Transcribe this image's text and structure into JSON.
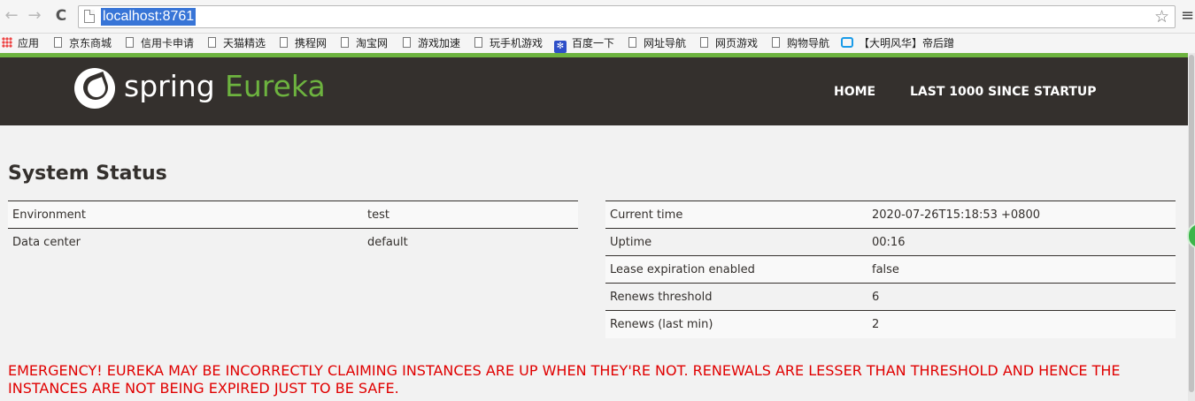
{
  "browser": {
    "url": "localhost:8761",
    "back_glyph": "←",
    "forward_glyph": "→",
    "reload_glyph": "C",
    "star_glyph": "☆",
    "menu_glyph": "≡",
    "bookmarks": [
      {
        "label": "应用",
        "icon": "apps-grid-icon"
      },
      {
        "label": "京东商城",
        "icon": "page-icon"
      },
      {
        "label": "信用卡申请",
        "icon": "page-icon"
      },
      {
        "label": "天猫精选",
        "icon": "page-icon"
      },
      {
        "label": "携程网",
        "icon": "page-icon"
      },
      {
        "label": "淘宝网",
        "icon": "page-icon"
      },
      {
        "label": "游戏加速",
        "icon": "page-icon"
      },
      {
        "label": "玩手机游戏",
        "icon": "page-icon"
      },
      {
        "label": "百度一下",
        "icon": "baidu-paw-icon"
      },
      {
        "label": "网址导航",
        "icon": "page-icon"
      },
      {
        "label": "网页游戏",
        "icon": "page-icon"
      },
      {
        "label": "购物导航",
        "icon": "page-icon"
      },
      {
        "label": "【大明风华】帝后蹭",
        "icon": "bilibili-tv-icon"
      }
    ]
  },
  "header": {
    "brand_spring": "spring",
    "brand_eureka": "Eureka",
    "nav": {
      "home": "HOME",
      "last1000": "LAST 1000 SINCE STARTUP"
    }
  },
  "main": {
    "section_title": "System Status",
    "left_table": [
      {
        "key": "Environment",
        "value": "test"
      },
      {
        "key": "Data center",
        "value": "default"
      }
    ],
    "right_table": [
      {
        "key": "Current time",
        "value": "2020-07-26T15:18:53 +0800"
      },
      {
        "key": "Uptime",
        "value": "00:16"
      },
      {
        "key": "Lease expiration enabled",
        "value": "false"
      },
      {
        "key": "Renews threshold",
        "value": "6"
      },
      {
        "key": "Renews (last min)",
        "value": "2"
      }
    ],
    "emergency": "EMERGENCY! EUREKA MAY BE INCORRECTLY CLAIMING INSTANCES ARE UP WHEN THEY'RE NOT. RENEWALS ARE LESSER THAN THRESHOLD AND HENCE THE INSTANCES ARE NOT BEING EXPIRED JUST TO BE SAFE."
  },
  "colors": {
    "header_bg": "#34302d",
    "brand_green": "#6db33f",
    "emergency_red": "#e00000",
    "url_highlight": "#3875d7"
  }
}
